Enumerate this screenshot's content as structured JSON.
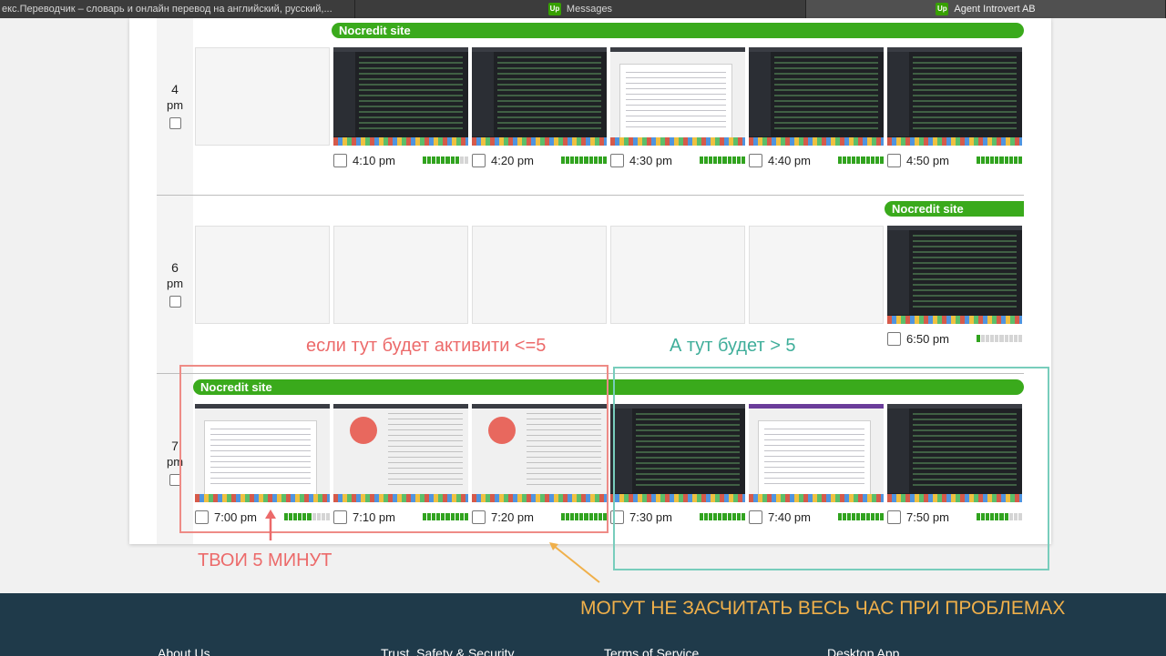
{
  "tabs": [
    {
      "label": "екс.Переводчик – словарь и онлайн перевод на английский, русский,...",
      "icon": false
    },
    {
      "label": "Messages",
      "icon": true
    },
    {
      "label": "Agent Introvert AB",
      "icon": true
    }
  ],
  "tab_icon_text": "Up",
  "hours": [
    {
      "num": "4",
      "pm": "pm"
    },
    {
      "num": "6",
      "pm": "pm"
    },
    {
      "num": "7",
      "pm": "pm"
    }
  ],
  "activity_label": "Nocredit site",
  "rows": {
    "r4": [
      {
        "time": "4:10 pm",
        "activity": 8
      },
      {
        "time": "4:20 pm",
        "activity": 10
      },
      {
        "time": "4:30 pm",
        "activity": 10
      },
      {
        "time": "4:40 pm",
        "activity": 10
      },
      {
        "time": "4:50 pm",
        "activity": 10
      }
    ],
    "r6": [
      {
        "time": "6:50 pm",
        "activity": 1
      }
    ],
    "r7": [
      {
        "time": "7:00 pm",
        "activity": 6
      },
      {
        "time": "7:10 pm",
        "activity": 10
      },
      {
        "time": "7:20 pm",
        "activity": 10
      },
      {
        "time": "7:30 pm",
        "activity": 10
      },
      {
        "time": "7:40 pm",
        "activity": 10
      },
      {
        "time": "7:50 pm",
        "activity": 7
      }
    ]
  },
  "annotations": {
    "left_note": "если тут будет активити <=5",
    "right_note": "А тут будет > 5",
    "your_minutes": "ТВОИ 5 МИНУТ",
    "warning": "МОГУТ НЕ ЗАСЧИТАТЬ ВЕСЬ ЧАС ПРИ ПРОБЛЕМАХ"
  },
  "footer": {
    "links": [
      "About Us",
      "Trust, Safety & Security",
      "Terms of Service",
      "Desktop App"
    ]
  },
  "colors": {
    "activity_green": "#3aaa1c",
    "note_red": "#ec6a6a",
    "note_teal": "#3fae9a",
    "note_orange": "#f0b04a",
    "footer_bg": "#1f3a4a"
  }
}
